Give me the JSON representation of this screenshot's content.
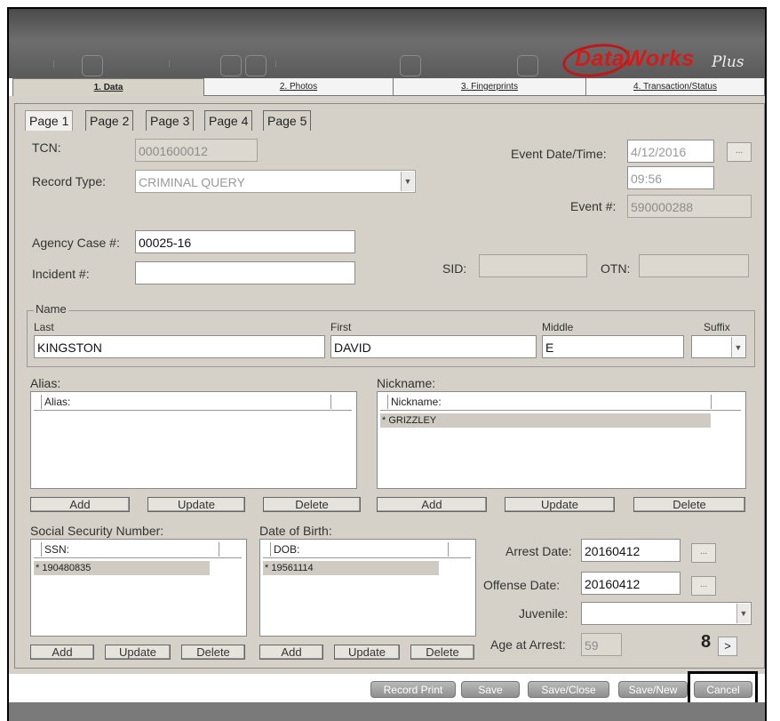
{
  "header": {
    "logo_text": "DataWorks",
    "logo_suffix": "Plus"
  },
  "main_tabs": [
    {
      "label": "1. Data",
      "active": true
    },
    {
      "label": "2. Photos",
      "active": false
    },
    {
      "label": "3. Fingerprints",
      "active": false
    },
    {
      "label": "4. Transaction/Status",
      "active": false
    }
  ],
  "sub_tabs": [
    "Page 1",
    "Page 2",
    "Page 3",
    "Page 4",
    "Page 5"
  ],
  "form": {
    "tcn_label": "TCN:",
    "tcn_value": "0001600012",
    "record_type_label": "Record Type:",
    "record_type_value": "CRIMINAL QUERY",
    "event_dt_label": "Event Date/Time:",
    "event_date": "4/12/2016",
    "event_time": "09:56",
    "event_dt_button": "...",
    "event_num_label": "Event #:",
    "event_num_value": "590000288",
    "agency_case_label": "Agency Case #:",
    "agency_case_value": "00025-16",
    "incident_label": "Incident #:",
    "incident_value": "",
    "sid_label": "SID:",
    "sid_value": "",
    "otn_label": "OTN:",
    "otn_value": ""
  },
  "name": {
    "group_label": "Name",
    "last_label": "Last",
    "last_value": "KINGSTON",
    "first_label": "First",
    "first_value": "DAVID",
    "middle_label": "Middle",
    "middle_value": "E",
    "suffix_label": "Suffix",
    "suffix_value": ""
  },
  "alias": {
    "label": "Alias:",
    "column": "Alias:",
    "rows": []
  },
  "nickname": {
    "label": "Nickname:",
    "column": "Nickname:",
    "rows": [
      "* GRIZZLEY"
    ]
  },
  "ssn": {
    "label": "Social Security Number:",
    "column": "SSN:",
    "rows": [
      "* 190480835"
    ]
  },
  "dob": {
    "label": "Date of Birth:",
    "column": "DOB:",
    "rows": [
      "* 19561114"
    ]
  },
  "buttons": {
    "add": "Add",
    "update": "Update",
    "delete": "Delete"
  },
  "arrest": {
    "arrest_date_label": "Arrest Date:",
    "arrest_date_value": "20160412",
    "offense_date_label": "Offense Date:",
    "offense_date_value": "20160412",
    "juvenile_label": "Juvenile:",
    "juvenile_value": "",
    "age_label": "Age at Arrest:",
    "age_value": "59",
    "date_button": "..."
  },
  "page_number": "8",
  "next_button": ">",
  "footer_buttons": [
    "Record Print",
    "Save",
    "Save/Close",
    "Save/New",
    "Cancel"
  ]
}
